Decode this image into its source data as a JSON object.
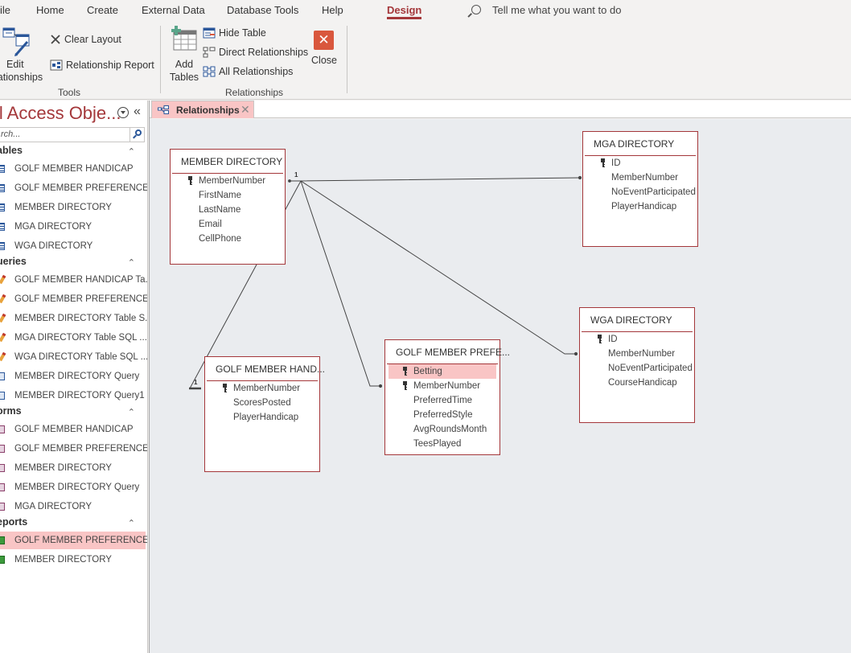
{
  "menubar": {
    "tabs": [
      "ile",
      "Home",
      "Create",
      "External Data",
      "Database Tools",
      "Help",
      "Design"
    ],
    "active_tab": "Design",
    "tell_me": "Tell me what you want to do"
  },
  "ribbon": {
    "tools_group": {
      "label": "Tools",
      "edit_relationships": [
        "Edit",
        "lationships"
      ],
      "clear_layout": "Clear Layout",
      "relationship_report": "Relationship Report"
    },
    "relationships_group": {
      "label": "Relationships",
      "add_tables": [
        "Add",
        "Tables"
      ],
      "hide_table": "Hide Table",
      "direct_relationships": "Direct Relationships",
      "all_relationships": "All Relationships",
      "close": "Close"
    }
  },
  "nav": {
    "title": "ll Access Obje...",
    "search_placeholder": "rch...",
    "sections": [
      {
        "label": "ables",
        "items": [
          {
            "label": "GOLF MEMBER HANDICAP",
            "type": "table"
          },
          {
            "label": "GOLF MEMBER PREFERENCES",
            "type": "table"
          },
          {
            "label": "MEMBER DIRECTORY",
            "type": "table"
          },
          {
            "label": "MGA DIRECTORY",
            "type": "table"
          },
          {
            "label": "WGA DIRECTORY",
            "type": "table"
          }
        ]
      },
      {
        "label": "ueries",
        "items": [
          {
            "label": "GOLF MEMBER HANDICAP Ta...",
            "type": "query-sql"
          },
          {
            "label": "GOLF MEMBER PREFERENCE...",
            "type": "query-sql"
          },
          {
            "label": "MEMBER DIRECTORY Table S...",
            "type": "query-sql"
          },
          {
            "label": "MGA DIRECTORY Table SQL ...",
            "type": "query-sql"
          },
          {
            "label": "WGA DIRECTORY Table SQL ...",
            "type": "query-sql"
          },
          {
            "label": "MEMBER DIRECTORY Query",
            "type": "query"
          },
          {
            "label": "MEMBER DIRECTORY Query1",
            "type": "query"
          }
        ]
      },
      {
        "label": "orms",
        "items": [
          {
            "label": "GOLF MEMBER HANDICAP",
            "type": "form"
          },
          {
            "label": "GOLF MEMBER PREFERENCES",
            "type": "form"
          },
          {
            "label": "MEMBER DIRECTORY",
            "type": "form"
          },
          {
            "label": "MEMBER DIRECTORY Query",
            "type": "form"
          },
          {
            "label": "MGA DIRECTORY",
            "type": "form"
          }
        ]
      },
      {
        "label": "eports",
        "items": [
          {
            "label": "GOLF MEMBER PREFERENCES",
            "type": "report",
            "selected": true
          },
          {
            "label": "MEMBER DIRECTORY",
            "type": "report"
          }
        ]
      }
    ]
  },
  "document_tab": {
    "label": "Relationships"
  },
  "tables": [
    {
      "name": "MEMBER DIRECTORY",
      "fields": [
        {
          "name": "MemberNumber",
          "key": true
        },
        {
          "name": "FirstName"
        },
        {
          "name": "LastName"
        },
        {
          "name": "Email"
        },
        {
          "name": "CellPhone"
        }
      ]
    },
    {
      "name": "MGA DIRECTORY",
      "fields": [
        {
          "name": "ID",
          "key": true
        },
        {
          "name": "MemberNumber"
        },
        {
          "name": "NoEventParticipated"
        },
        {
          "name": "PlayerHandicap"
        }
      ]
    },
    {
      "name": "WGA DIRECTORY",
      "fields": [
        {
          "name": "ID",
          "key": true
        },
        {
          "name": "MemberNumber"
        },
        {
          "name": "NoEventParticipated"
        },
        {
          "name": "CourseHandicap"
        }
      ]
    },
    {
      "name": "GOLF MEMBER PREFE...",
      "fields": [
        {
          "name": "Betting",
          "key": true,
          "highlighted": true
        },
        {
          "name": "MemberNumber",
          "key": true
        },
        {
          "name": "PreferredTime"
        },
        {
          "name": "PreferredStyle"
        },
        {
          "name": "AvgRoundsMonth"
        },
        {
          "name": "TeesPlayed"
        }
      ]
    },
    {
      "name": "GOLF MEMBER HAND...",
      "fields": [
        {
          "name": "MemberNumber",
          "key": true
        },
        {
          "name": "ScoresPosted"
        },
        {
          "name": "PlayerHandicap"
        }
      ]
    }
  ],
  "relationships": [
    {
      "from": "MEMBER DIRECTORY.MemberNumber",
      "to": "MGA DIRECTORY.MemberNumber",
      "from_cardinality": "1"
    },
    {
      "from": "MEMBER DIRECTORY.MemberNumber",
      "to": "WGA DIRECTORY.MemberNumber",
      "from_cardinality": "1"
    },
    {
      "from": "MEMBER DIRECTORY.MemberNumber",
      "to": "GOLF MEMBER PREFERENCES.MemberNumber",
      "from_cardinality": "1"
    },
    {
      "from": "MEMBER DIRECTORY.MemberNumber",
      "to": "GOLF MEMBER HANDICAP.MemberNumber",
      "to_cardinality": "1"
    }
  ],
  "colors": {
    "accent": "#a4373a",
    "selection": "#f9c5c5",
    "canvas": "#eaecef",
    "close_button": "#d9573d"
  }
}
